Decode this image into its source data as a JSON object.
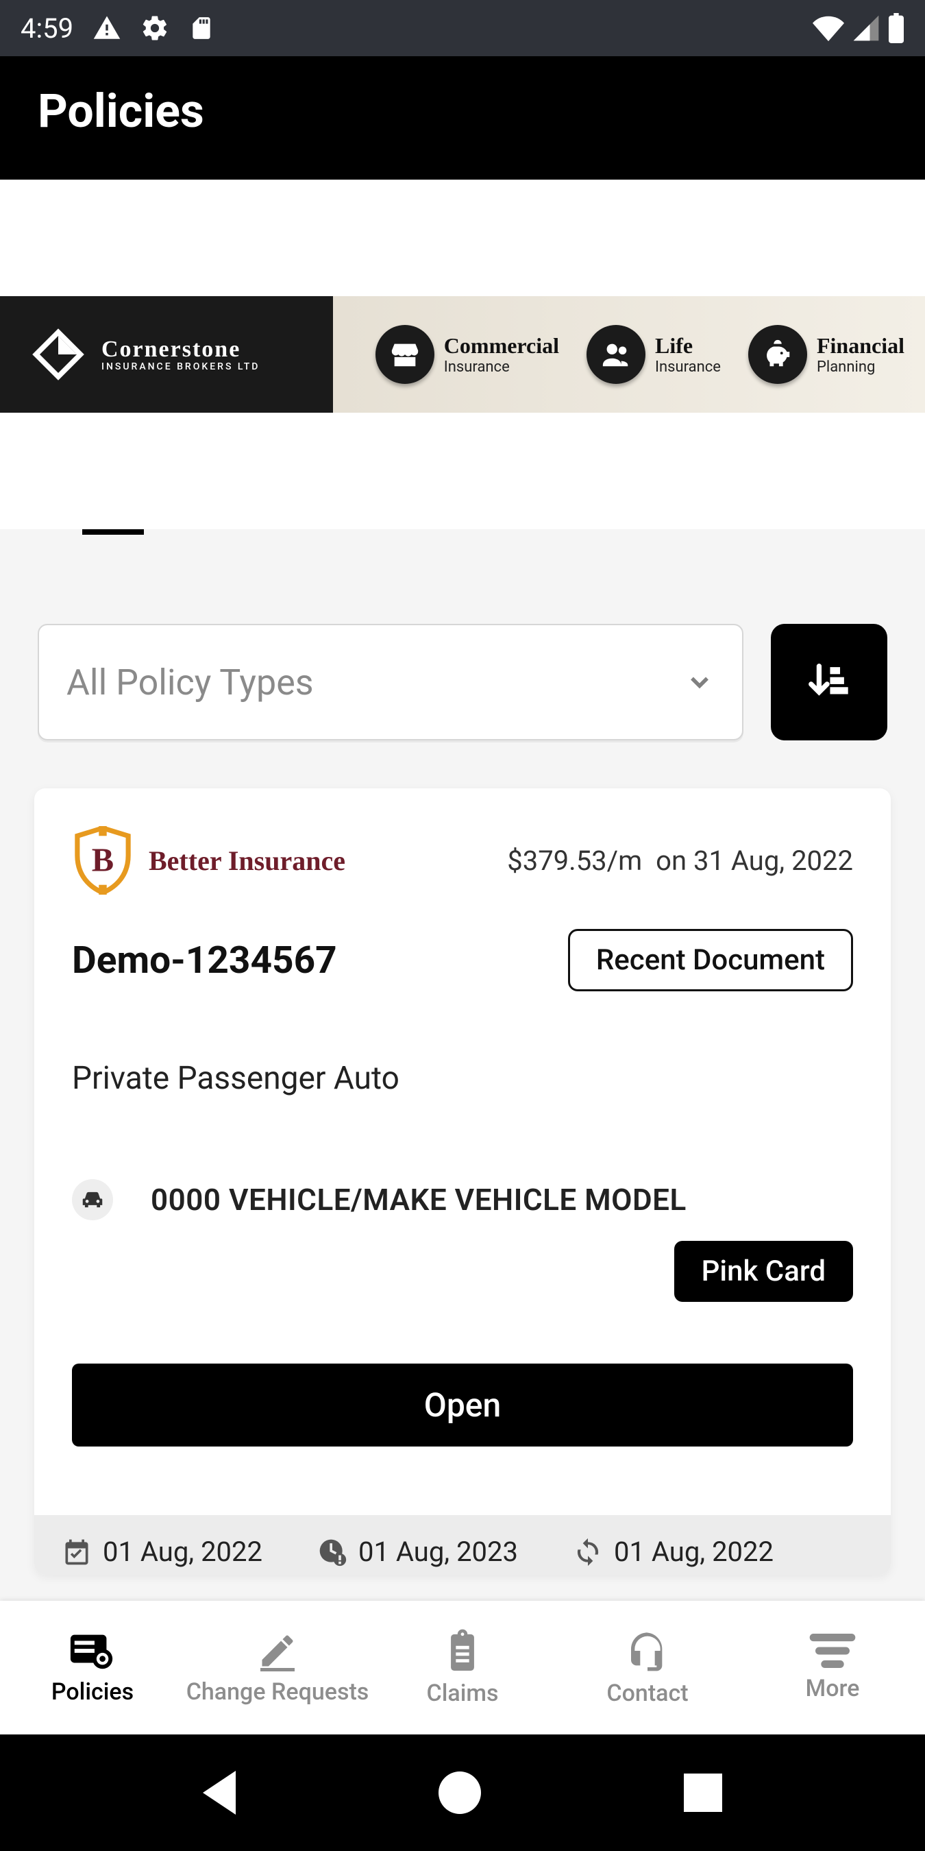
{
  "status": {
    "time": "4:59"
  },
  "header": {
    "title": "Policies"
  },
  "banner": {
    "brand_main": "Cornerstone",
    "brand_sub": "INSURANCE BROKERS LTD",
    "services": [
      {
        "title": "Commercial",
        "sub": "Insurance"
      },
      {
        "title": "Life",
        "sub": "Insurance"
      },
      {
        "title": "Financial",
        "sub": "Planning"
      }
    ]
  },
  "filter": {
    "dropdown_label": "All Policy Types"
  },
  "policy": {
    "insurer_name": "Better Insurance",
    "premium": "$379.53/m",
    "premium_date_prefix": "on",
    "premium_date": "31 Aug, 2022",
    "number": "Demo-1234567",
    "recent_doc_label": "Recent Document",
    "type": "Private Passenger Auto",
    "vehicle": "0000 VEHICLE/MAKE VEHICLE MODEL",
    "pink_card_label": "Pink Card",
    "open_label": "Open",
    "dates": {
      "start": "01 Aug, 2022",
      "end": "01 Aug, 2023",
      "renew": "01 Aug, 2022"
    }
  },
  "tabs": {
    "policies": "Policies",
    "change": "Change Requests",
    "claims": "Claims",
    "contact": "Contact",
    "more": "More"
  }
}
